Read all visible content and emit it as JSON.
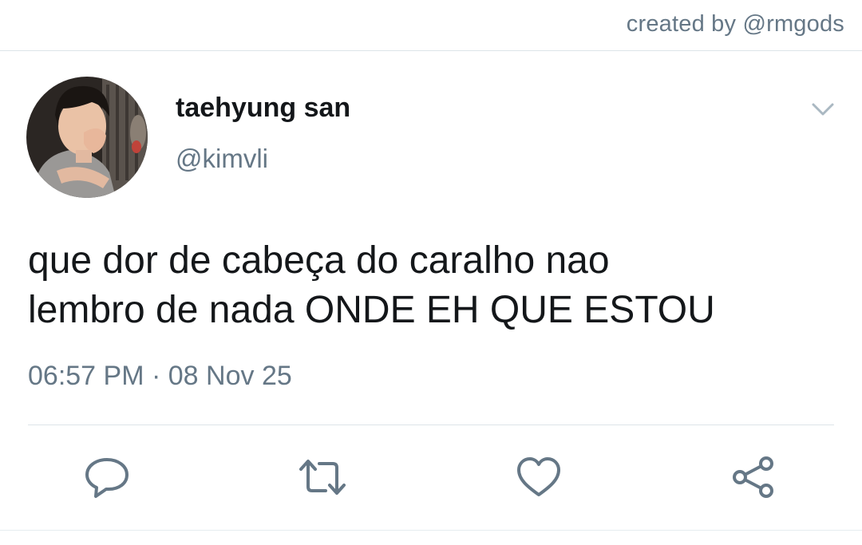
{
  "credit": "created by @rmgods",
  "author": {
    "display_name": "taehyung san",
    "handle": "@kimvli",
    "avatar": "profile-photo"
  },
  "tweet": {
    "lines": [
      "que dor de cabeça do caralho nao",
      "lembro de nada ONDE EH QUE ESTOU"
    ],
    "time": "06:57 PM",
    "separator": "·",
    "date": "08 Nov 25"
  },
  "icons": {
    "menu": "chevron-down-icon",
    "reply": "reply-icon",
    "retweet": "retweet-icon",
    "like": "heart-icon",
    "share": "share-icon"
  },
  "colors": {
    "text": "#14171a",
    "secondary": "#657786",
    "divider": "#dde4e8"
  }
}
